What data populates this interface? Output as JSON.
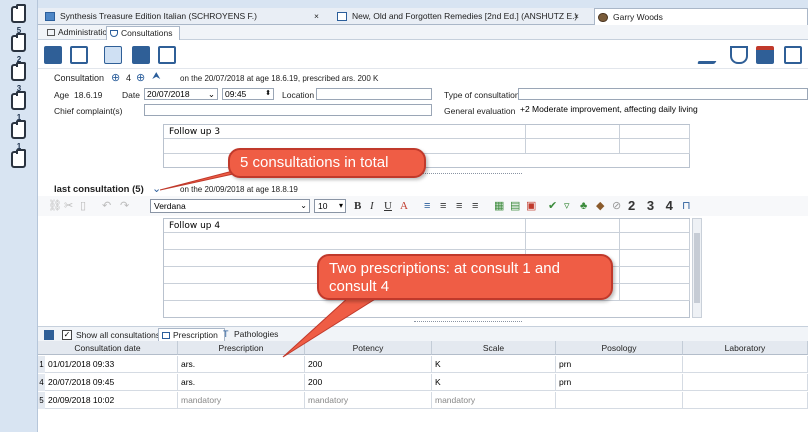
{
  "left_sidebar": {
    "items": [
      {
        "number": ""
      },
      {
        "number": "5"
      },
      {
        "number": "2"
      },
      {
        "number": "3"
      },
      {
        "number": "1"
      },
      {
        "number": "1"
      }
    ]
  },
  "document_tabs": [
    {
      "label": "Synthesis Treasure Edition Italian (SCHROYENS F.)",
      "close": "×"
    },
    {
      "label": "New, Old and Forgotten Remedies [2nd Ed.] (ANSHUTZ E.)",
      "close": "×"
    },
    {
      "label": "Garry Woods",
      "close": ""
    }
  ],
  "sub_tabs": [
    {
      "label": "Administration"
    },
    {
      "label": "Consultations"
    }
  ],
  "consultation": {
    "label": "Consultation",
    "number": "4",
    "info": "on the 20/07/2018 at age 18.6.19, prescribed ars. 200 K",
    "age_label": "Age",
    "age_value": "18.6.19",
    "date_label": "Date",
    "date_value": "20/07/2018",
    "time_value": "09:45",
    "location_label": "Location",
    "location_value": "",
    "type_label": "Type of consultation",
    "type_value": "",
    "chief_complaint_label": "Chief complaint(s)",
    "chief_complaint_value": "",
    "general_eval_label": "General evaluation",
    "general_eval_value": "+2  Moderate improvement, affecting daily living",
    "note": "Follow up 3"
  },
  "last_consultation": {
    "label": "last consultation (5)",
    "info": "on the 20/09/2018 at age 18.8.19",
    "font": "Verdana",
    "font_size": "10",
    "format_numbers": "2 3 4",
    "note": "Follow up 4"
  },
  "callouts": {
    "total": "5 consultations in total",
    "prescriptions": "Two prescriptions: at consult 1 and consult 4"
  },
  "bottom_tabs": {
    "show_all": "Show all consultations",
    "prescription": "Prescription",
    "pathologies": "Pathologies"
  },
  "table": {
    "headers": [
      "Consultation date",
      "Prescription",
      "Potency",
      "Scale",
      "Posology",
      "Laboratory"
    ],
    "rows": [
      {
        "num": "1",
        "date": "01/01/2018 09:33",
        "prescription": "ars.",
        "potency": "200",
        "scale": "K",
        "posology": "prn",
        "laboratory": "",
        "muted": false
      },
      {
        "num": "4",
        "date": "20/07/2018 09:45",
        "prescription": "ars.",
        "potency": "200",
        "scale": "K",
        "posology": "prn",
        "laboratory": "",
        "muted": false
      },
      {
        "num": "5",
        "date": "20/09/2018 10:02",
        "prescription": "mandatory",
        "potency": "mandatory",
        "scale": "mandatory",
        "posology": "",
        "laboratory": "",
        "muted": true
      }
    ]
  },
  "colors": {
    "callout": "#ef5d45",
    "sidebar": "#d8e4f2",
    "accent": "#2b5e9b"
  }
}
